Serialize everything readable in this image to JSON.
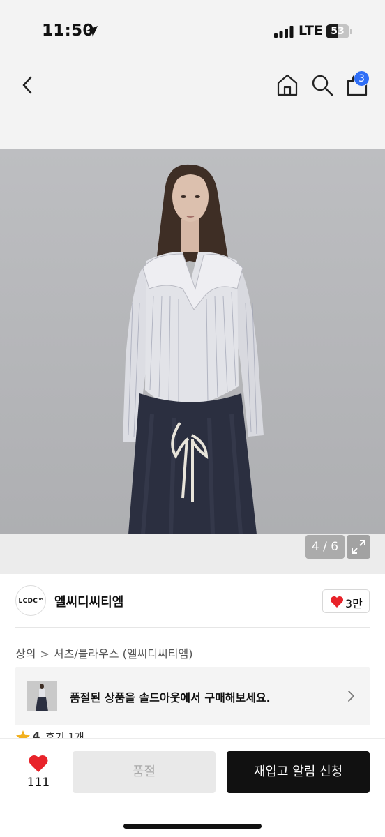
{
  "status_bar": {
    "time": "11:50",
    "network": "LTE",
    "battery_level": "53",
    "battery_fraction": 0.53
  },
  "nav": {
    "back_icon": "chevron-left-icon",
    "home_icon": "home-icon",
    "search_icon": "search-icon",
    "cart_icon": "shopping-bag-icon",
    "cart_badge": "3",
    "badge_color": "#2f6ef6"
  },
  "gallery": {
    "counter": "4 / 6",
    "expand_icon": "expand-icon"
  },
  "brand": {
    "logo_text": "LCDC™",
    "name": "엘씨디씨티엠",
    "likes": "3만",
    "heart_color": "#e8232a"
  },
  "breadcrumb": {
    "category": "상의",
    "subcategory": "셔츠/블라우스 (엘씨디씨티엠)"
  },
  "soldout_banner": {
    "text": "품절된 상품을 솔드아웃에서 구매해보세요."
  },
  "review": {
    "rating": "4",
    "count": "후기 1개"
  },
  "bottom_bar": {
    "wish_count": "111",
    "soldout_label": "품절",
    "restock_label": "재입고 알림 신청"
  }
}
